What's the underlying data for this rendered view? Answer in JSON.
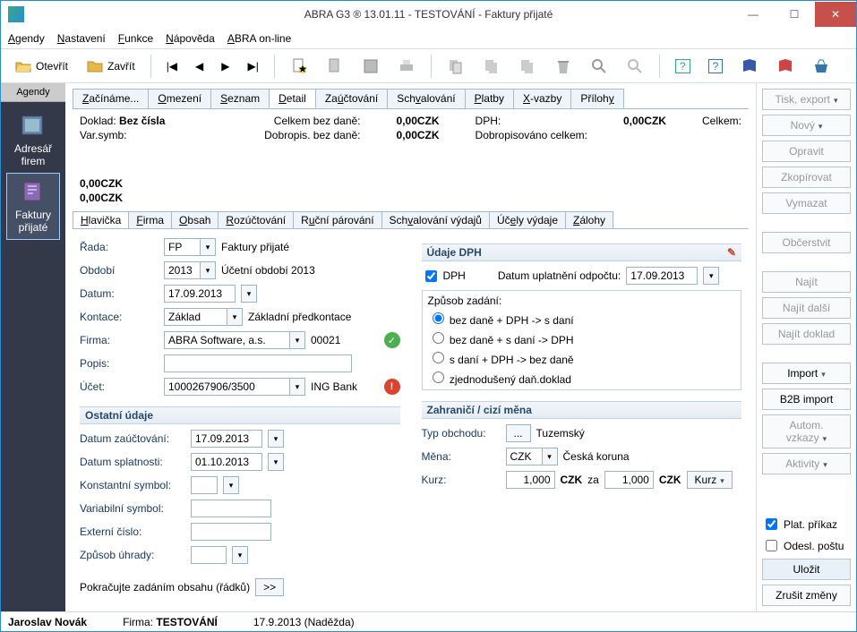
{
  "title": "ABRA G3 ® 13.01.11 - TESTOVÁNÍ - Faktury přijaté",
  "menus": {
    "agendy": "Agendy",
    "nastaveni": "Nastavení",
    "funkce": "Funkce",
    "napoveda": "Nápověda",
    "abra_online": "ABRA on-line"
  },
  "toolbar": {
    "open": "Otevřít",
    "close": "Zavřít"
  },
  "sidebar": {
    "tab": "Agendy",
    "item1": "Adresář firem",
    "item2": "Faktury přijaté"
  },
  "tabs": {
    "t0": "Začínáme...",
    "t1": "Omezení",
    "t2": "Seznam",
    "t3": "Detail",
    "t4": "Zaúčtování",
    "t5": "Schvalování",
    "t6": "Platby",
    "t7": "X-vazby",
    "t8": "Přílohy"
  },
  "summary": {
    "doklad_label": "Doklad:",
    "doklad_value": "Bez čísla",
    "varsymb_label": "Var.symb:",
    "celkem_bez_label": "Celkem bez daně:",
    "celkem_bez_value": "0,00CZK",
    "dobropis_label": "Dobropis. bez daně:",
    "dobropis_value": "0,00CZK",
    "dph_label": "DPH:",
    "dph_value": "0,00CZK",
    "dobrop_celkem_label": "Dobropisováno celkem:",
    "celkem_label": "Celkem:",
    "celkem_value": "0,00CZK",
    "celkem_value2": "0,00CZK"
  },
  "subtabs": {
    "s0": "Hlavička",
    "s1": "Firma",
    "s2": "Obsah",
    "s3": "Rozúčtování",
    "s4": "Ruční párování",
    "s5": "Schvalování výdajů",
    "s6": "Účely výdaje",
    "s7": "Zálohy"
  },
  "form": {
    "rada_label": "Řada:",
    "rada_value": "FP",
    "rada_text": "Faktury přijaté",
    "obdobi_label": "Období",
    "obdobi_value": "2013",
    "obdobi_text": "Účetní období 2013",
    "datum_label": "Datum:",
    "datum_value": "17.09.2013",
    "kontace_label": "Kontace:",
    "kontace_value": "Základ",
    "kontace_text": "Základní předkontace",
    "firma_label": "Firma:",
    "firma_value": "ABRA Software, a.s.",
    "firma_code": "00021",
    "popis_label": "Popis:",
    "ucet_label": "Účet:",
    "ucet_value": "1000267906/3500",
    "ucet_text": "ING Bank",
    "ostatni_hdr": "Ostatní údaje",
    "datum_zauct_label": "Datum zaúčtování:",
    "datum_zauct_value": "17.09.2013",
    "datum_splat_label": "Datum splatnosti:",
    "datum_splat_value": "01.10.2013",
    "konst_symbol_label": "Konstantní symbol:",
    "var_symbol_label": "Variabilní symbol:",
    "ext_cislo_label": "Externí číslo:",
    "zpusob_uhrady_label": "Způsob úhrady:",
    "pokracujte": "Pokračujte zadáním obsahu (řádků)",
    "next_btn": ">>"
  },
  "dph": {
    "hdr": "Údaje DPH",
    "dph_check": "DPH",
    "datum_odp_label": "Datum uplatnění odpočtu:",
    "datum_odp_value": "17.09.2013",
    "zpusob_label": "Způsob zadání:",
    "r1": "bez daně + DPH -> s daní",
    "r2": "bez daně + s daní -> DPH",
    "r3": "s daní + DPH -> bez daně",
    "r4": "zjednodušený daň.doklad",
    "zahr_hdr": "Zahraničí / cizí měna",
    "typ_obchodu_label": "Typ obchodu:",
    "typ_obchodu_value": "Tuzemský",
    "typ_obchodu_btn": "...",
    "mena_label": "Měna:",
    "mena_value": "CZK",
    "mena_text": "Česká koruna",
    "kurz_label": "Kurz:",
    "kurz_value1": "1,000",
    "kurz_c1": "CZK",
    "kurz_za": "za",
    "kurz_value2": "1,000",
    "kurz_c2": "CZK",
    "kurz_btn": "Kurz"
  },
  "right": {
    "tisk": "Tisk, export",
    "novy": "Nový",
    "opravit": "Opravit",
    "zkopirovat": "Zkopírovat",
    "vymazat": "Vymazat",
    "obcerstvit": "Občerstvit",
    "najit": "Najít",
    "najit_dalsi": "Najít další",
    "najit_doklad": "Najít doklad",
    "import": "Import",
    "b2b": "B2B import",
    "autom": "Autom. vzkazy",
    "aktivity": "Aktivity",
    "plat_prikaz": "Plat. příkaz",
    "odesl_postu": "Odesl. poštu",
    "ulozit": "Uložit",
    "zrusit": "Zrušit změny"
  },
  "status": {
    "user": "Jaroslav Novák",
    "firma_label": "Firma:",
    "firma": "TESTOVÁNÍ",
    "date": "17.9.2013 (Naděžda)"
  }
}
